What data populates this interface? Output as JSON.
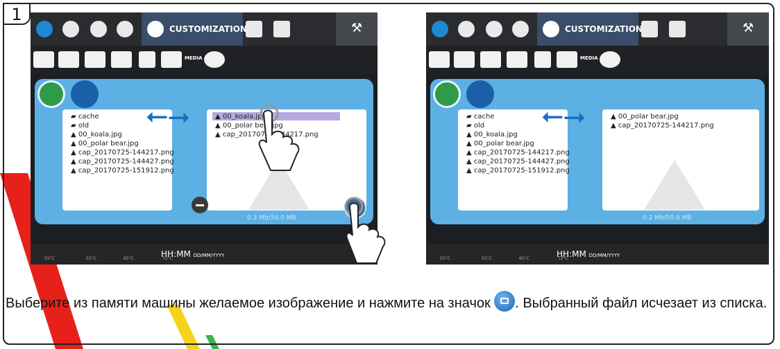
{
  "step": {
    "number": "1"
  },
  "screen_left": {
    "tab_label": "CUSTOMIZATION",
    "media_label": "MEDIA",
    "machine_files": [
      "cache",
      "old",
      "00_koala.jpg",
      "00_polar bear.jpg",
      "cap_20170725-144217.png",
      "cap_20170725-144427.png",
      "cap_20170725-151912.png"
    ],
    "usb_files": [
      "00_koala.jpg",
      "00_polar bear.jpg",
      "cap_20170725-144217.png"
    ],
    "memory": "0.3 Mb/50.0 MB",
    "clock": "HH:MM",
    "date": "DD/MM/YYYY",
    "temps": [
      "55°C",
      "55°C",
      "65°C",
      "72°C"
    ]
  },
  "screen_right": {
    "tab_label": "CUSTOMIZATION",
    "media_label": "MEDIA",
    "machine_files": [
      "cache",
      "old",
      "00_koala.jpg",
      "00_polar bear.jpg",
      "cap_20170725-144217.png",
      "cap_20170725-144427.png",
      "cap_20170725-151912.png"
    ],
    "usb_files": [
      "00_polar bear.jpg",
      "cap_20170725-144217.png"
    ],
    "memory": "0.2 Mb/50.0 MB",
    "clock": "HH:MM",
    "date": "DD/MM/YYYY",
    "temps": [
      "55°C",
      "55°C",
      "65°C",
      "72°C"
    ]
  },
  "caption": {
    "before": "Выберите из памяти машины желаемое изображение и нажмите на значок ",
    "after": ". Выбранный файл исчезает из списка."
  },
  "colors": {
    "panel": "#5cb0e4",
    "tab_active": "#3a4d6a",
    "stripe_red": "#e8201a",
    "stripe_yellow": "#f6d21a",
    "stripe_green": "#3fb24a"
  },
  "icons": {
    "folder": "folder-icon",
    "image": "image-file-icon",
    "usb": "usb-icon",
    "add": "add-image-icon",
    "remove": "minus-icon"
  }
}
